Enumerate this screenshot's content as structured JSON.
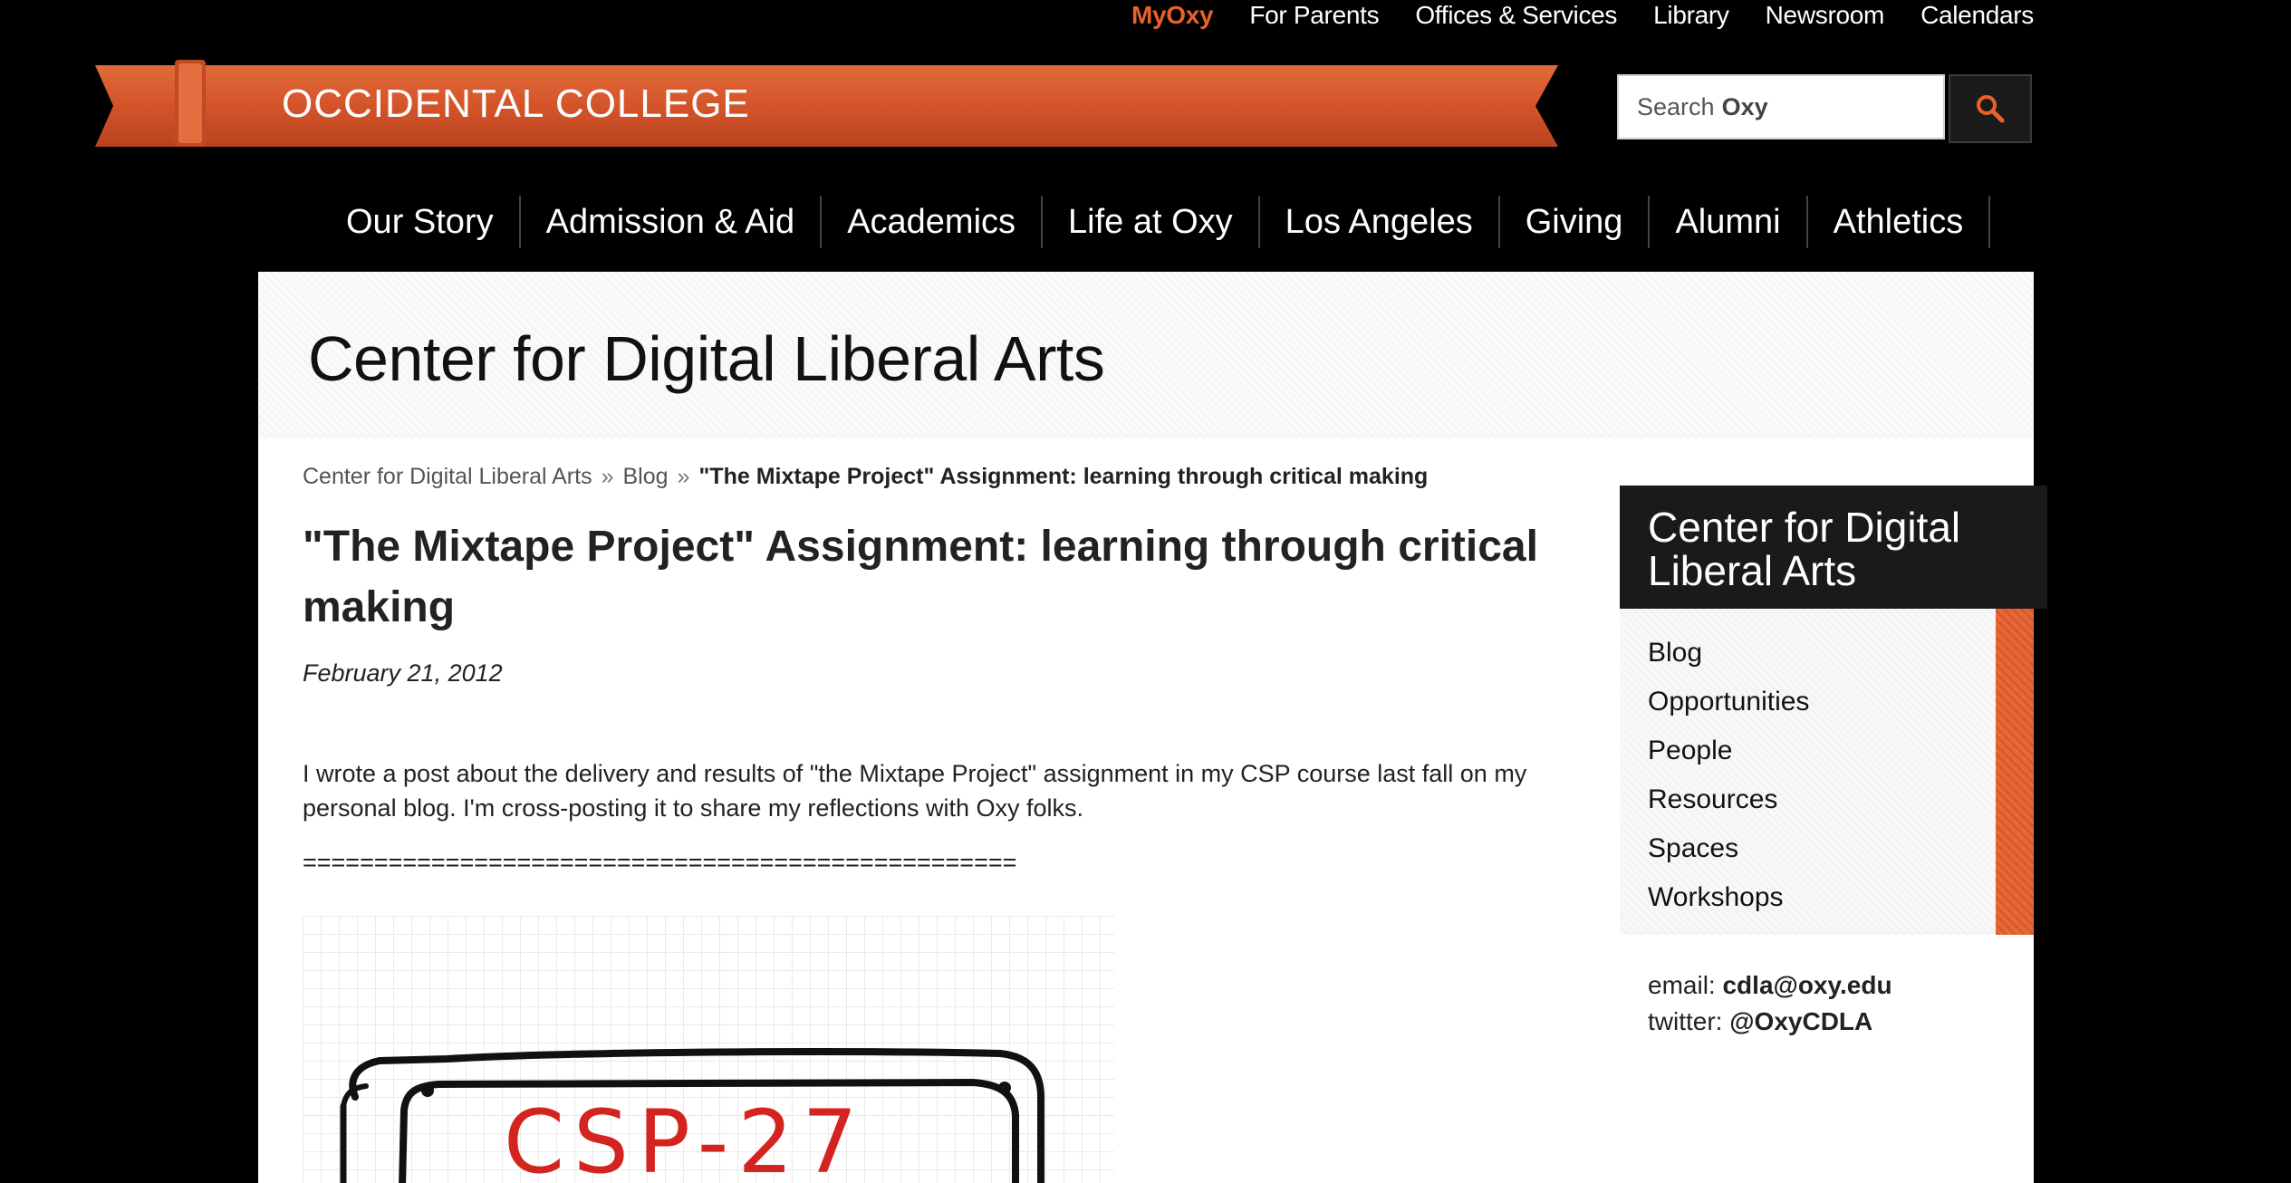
{
  "utility_nav": [
    {
      "label": "MyOxy",
      "active": true
    },
    {
      "label": "For Parents",
      "active": false
    },
    {
      "label": "Offices & Services",
      "active": false
    },
    {
      "label": "Library",
      "active": false
    },
    {
      "label": "Newsroom",
      "active": false
    },
    {
      "label": "Calendars",
      "active": false
    }
  ],
  "banner": {
    "title": "OCCIDENTAL COLLEGE"
  },
  "search": {
    "placeholder_prefix": "Search",
    "placeholder_bold": "Oxy",
    "button_icon": "search-icon"
  },
  "main_nav": [
    "Our Story",
    "Admission & Aid",
    "Academics",
    "Life at Oxy",
    "Los Angeles",
    "Giving",
    "Alumni",
    "Athletics"
  ],
  "section": {
    "title": "Center for Digital Liberal Arts"
  },
  "breadcrumb": {
    "items": [
      "Center for Digital Liberal Arts",
      "Blog"
    ],
    "separator": "»",
    "current": "\"The Mixtape Project\" Assignment: learning through critical making"
  },
  "article": {
    "title": "\"The Mixtape Project\" Assignment: learning through critical making",
    "date": "February 21, 2012",
    "body": "I wrote a post about the delivery and results of \"the Mixtape Project\" assignment in my CSP course last fall on my personal blog. I'm cross-posting it to share my reflections with Oxy folks.",
    "divider": "==================================================",
    "image_text": "CSP-27"
  },
  "sidebar": {
    "title": "Center for Digital Liberal Arts",
    "items": [
      "Blog",
      "Opportunities",
      "People",
      "Resources",
      "Spaces",
      "Workshops"
    ],
    "contact": {
      "email_label": "email:",
      "email": "cdla@oxy.edu",
      "twitter_label": "twitter:",
      "twitter": "@OxyCDLA"
    }
  },
  "colors": {
    "accent": "#e8622a",
    "banner": "#d9592a",
    "background": "#000000"
  }
}
